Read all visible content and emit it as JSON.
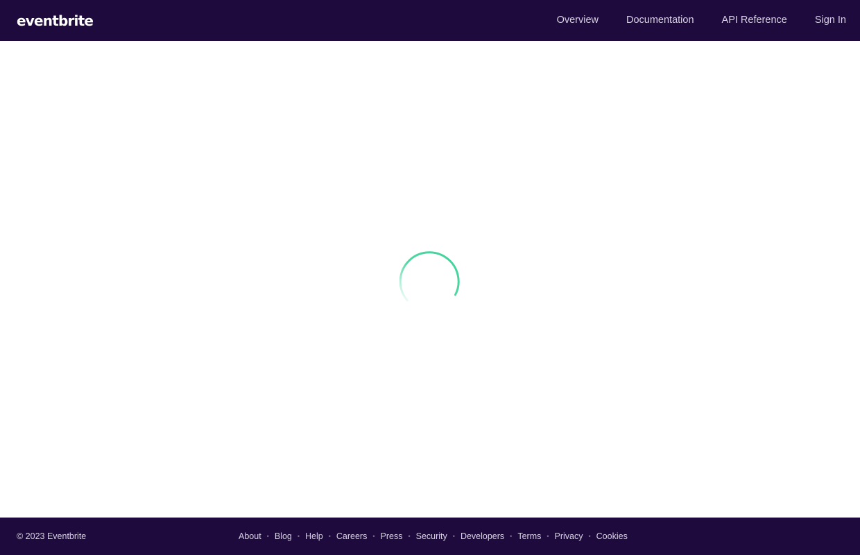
{
  "header": {
    "logo": "eventbrite",
    "nav": [
      {
        "label": "Overview"
      },
      {
        "label": "Documentation"
      },
      {
        "label": "API Reference"
      },
      {
        "label": "Sign In"
      }
    ]
  },
  "main": {
    "spinner_color": "#3fd29a"
  },
  "footer": {
    "copyright": "© 2023 Eventbrite",
    "links": [
      {
        "label": "About"
      },
      {
        "label": "Blog"
      },
      {
        "label": "Help"
      },
      {
        "label": "Careers"
      },
      {
        "label": "Press"
      },
      {
        "label": "Security"
      },
      {
        "label": "Developers"
      },
      {
        "label": "Terms"
      },
      {
        "label": "Privacy"
      },
      {
        "label": "Cookies"
      }
    ],
    "separator": "•"
  },
  "colors": {
    "brand_dark": "#1e0a3c",
    "nav_text": "#d8d2e6"
  }
}
